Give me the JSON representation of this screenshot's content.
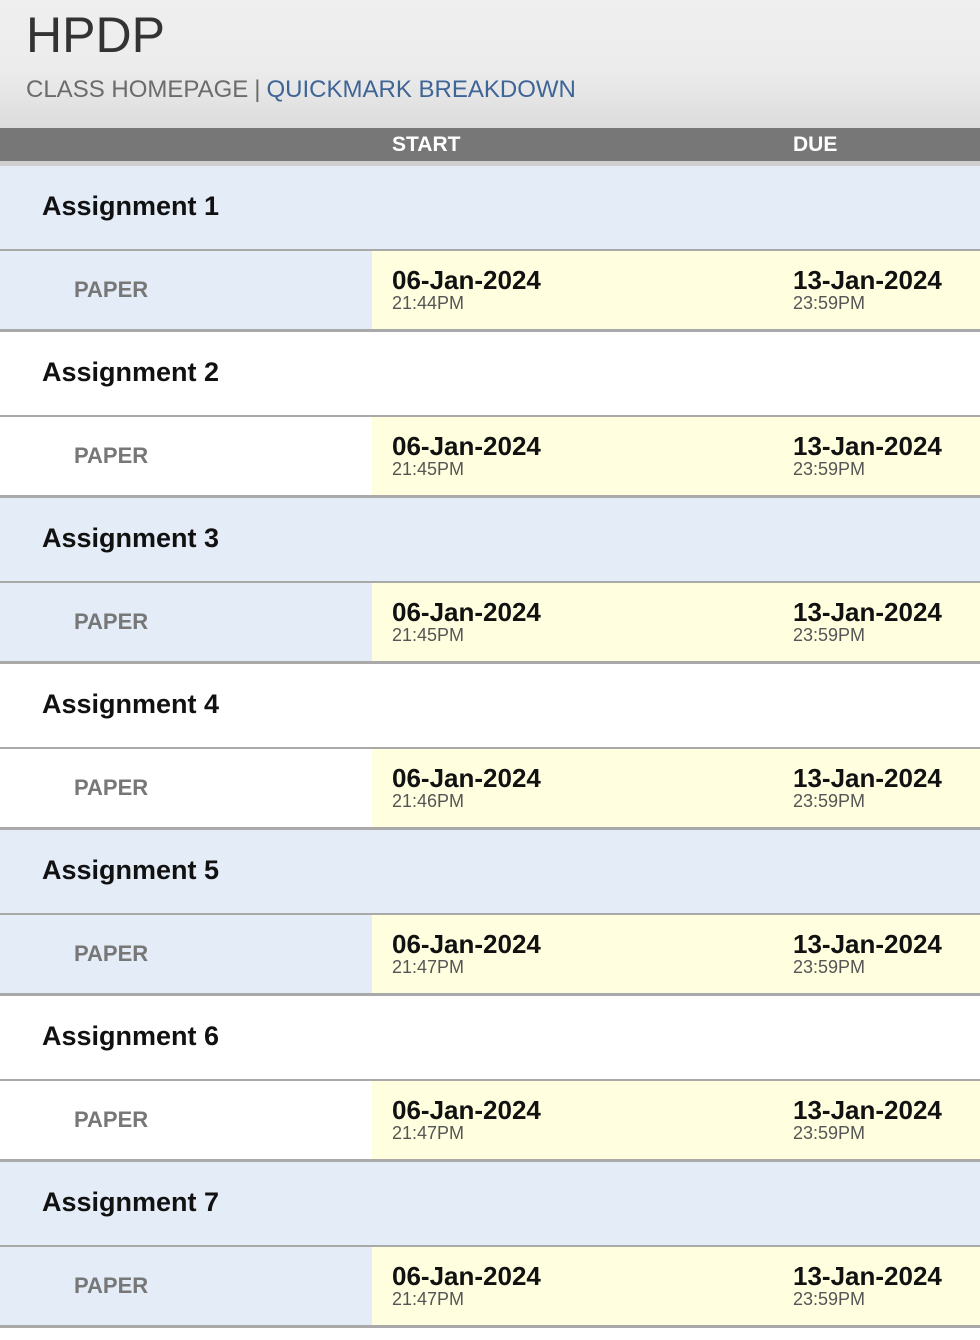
{
  "header": {
    "class_name": "HPDP",
    "nav_home": "CLASS HOMEPAGE",
    "nav_separator": "|",
    "nav_quickmark": "QUICKMARK BREAKDOWN"
  },
  "columns": {
    "start": "START",
    "due": "DUE"
  },
  "assignments": [
    {
      "title": "Assignment 1",
      "part": "PAPER",
      "start_date": "06-Jan-2024",
      "start_time": "21:44PM",
      "due_date": "13-Jan-2024",
      "due_time": "23:59PM"
    },
    {
      "title": "Assignment 2",
      "part": "PAPER",
      "start_date": "06-Jan-2024",
      "start_time": "21:45PM",
      "due_date": "13-Jan-2024",
      "due_time": "23:59PM"
    },
    {
      "title": "Assignment 3",
      "part": "PAPER",
      "start_date": "06-Jan-2024",
      "start_time": "21:45PM",
      "due_date": "13-Jan-2024",
      "due_time": "23:59PM"
    },
    {
      "title": "Assignment 4",
      "part": "PAPER",
      "start_date": "06-Jan-2024",
      "start_time": "21:46PM",
      "due_date": "13-Jan-2024",
      "due_time": "23:59PM"
    },
    {
      "title": "Assignment 5",
      "part": "PAPER",
      "start_date": "06-Jan-2024",
      "start_time": "21:47PM",
      "due_date": "13-Jan-2024",
      "due_time": "23:59PM"
    },
    {
      "title": "Assignment 6",
      "part": "PAPER",
      "start_date": "06-Jan-2024",
      "start_time": "21:47PM",
      "due_date": "13-Jan-2024",
      "due_time": "23:59PM"
    },
    {
      "title": "Assignment 7",
      "part": "PAPER",
      "start_date": "06-Jan-2024",
      "start_time": "21:47PM",
      "due_date": "13-Jan-2024",
      "due_time": "23:59PM"
    }
  ]
}
